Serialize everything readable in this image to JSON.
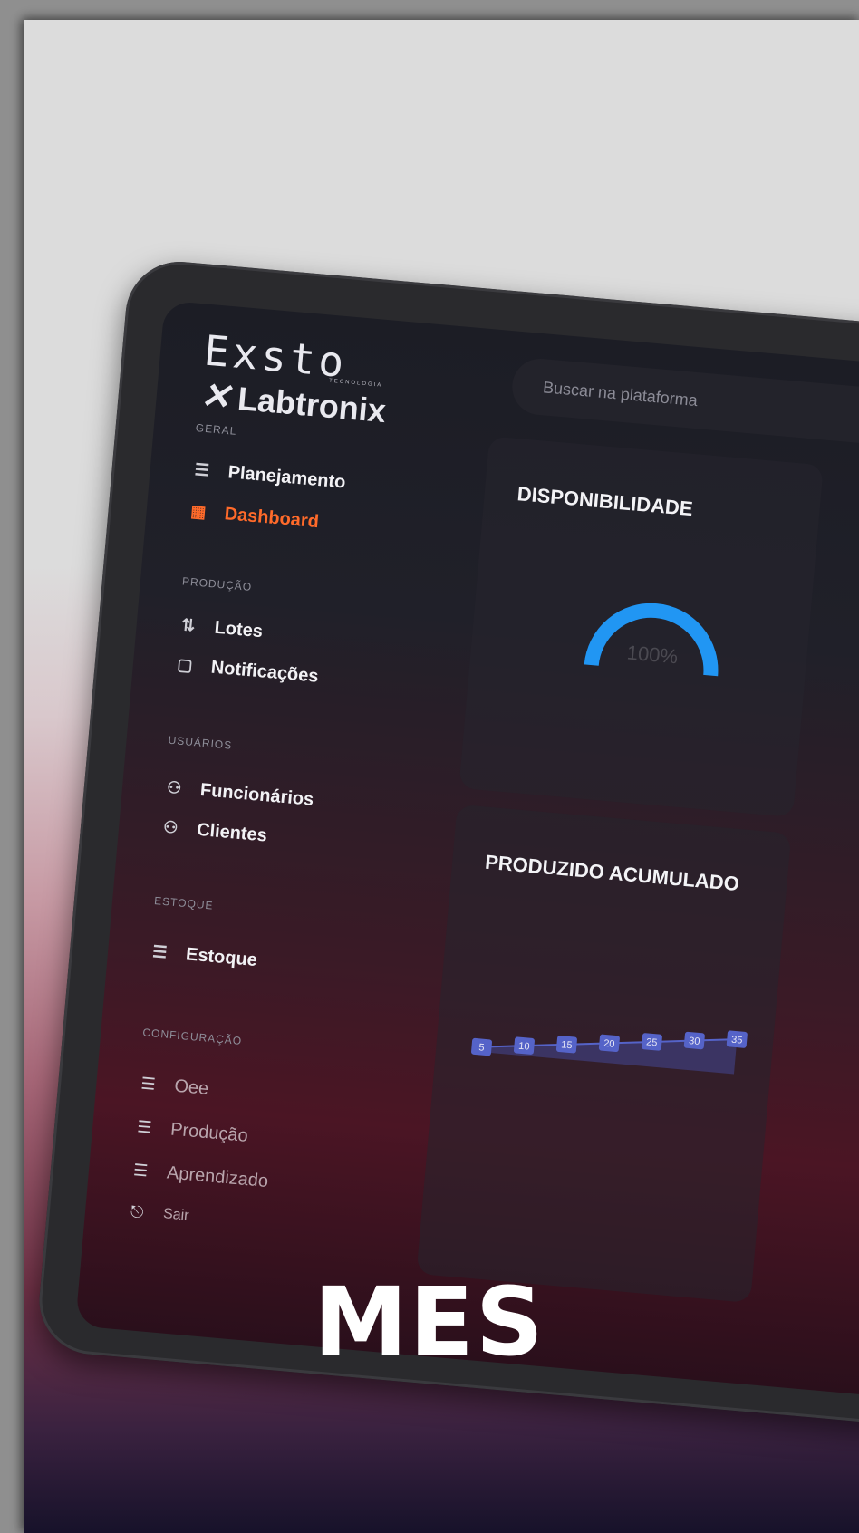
{
  "brand": {
    "name_top": "Exsto",
    "name_sub": "TECNOLOGIA",
    "name_bottom": "Labtronix"
  },
  "search": {
    "placeholder": "Buscar na plataforma"
  },
  "sidebar": {
    "sections": [
      {
        "label": "GERAL",
        "items": [
          {
            "label": "Planejamento",
            "icon": "list-icon"
          },
          {
            "label": "Dashboard",
            "icon": "dashboard-icon",
            "active": true
          }
        ]
      },
      {
        "label": "PRODUÇÃO",
        "items": [
          {
            "label": "Lotes",
            "icon": "lots-icon"
          },
          {
            "label": "Notificações",
            "icon": "notification-icon"
          }
        ]
      },
      {
        "label": "USUÁRIOS",
        "items": [
          {
            "label": "Funcionários",
            "icon": "users-icon"
          },
          {
            "label": "Clientes",
            "icon": "users-icon"
          }
        ]
      },
      {
        "label": "ESTOQUE",
        "items": [
          {
            "label": "Estoque",
            "icon": "list-icon"
          }
        ]
      },
      {
        "label": "CONFIGURAÇÃO",
        "items": [
          {
            "label": "Oee",
            "icon": "list-icon"
          },
          {
            "label": "Produção",
            "icon": "list-icon"
          },
          {
            "label": "Aprendizado",
            "icon": "list-icon"
          },
          {
            "label": "Sair",
            "icon": "logout-icon"
          }
        ]
      }
    ]
  },
  "cards": {
    "availability": {
      "title": "DISPONIBILIDADE",
      "value": "100%",
      "percent": 100,
      "color": "#2196f3"
    },
    "production": {
      "title": "PRODUZIDO ACUMULADO"
    }
  },
  "chart_data": {
    "type": "area",
    "series": [
      {
        "values": [
          5,
          10,
          15,
          20,
          25,
          30,
          35
        ]
      }
    ],
    "color": "#5563c8"
  },
  "caption": "MES",
  "colors": {
    "accent": "#ff6a2a",
    "gauge": "#2196f3"
  }
}
